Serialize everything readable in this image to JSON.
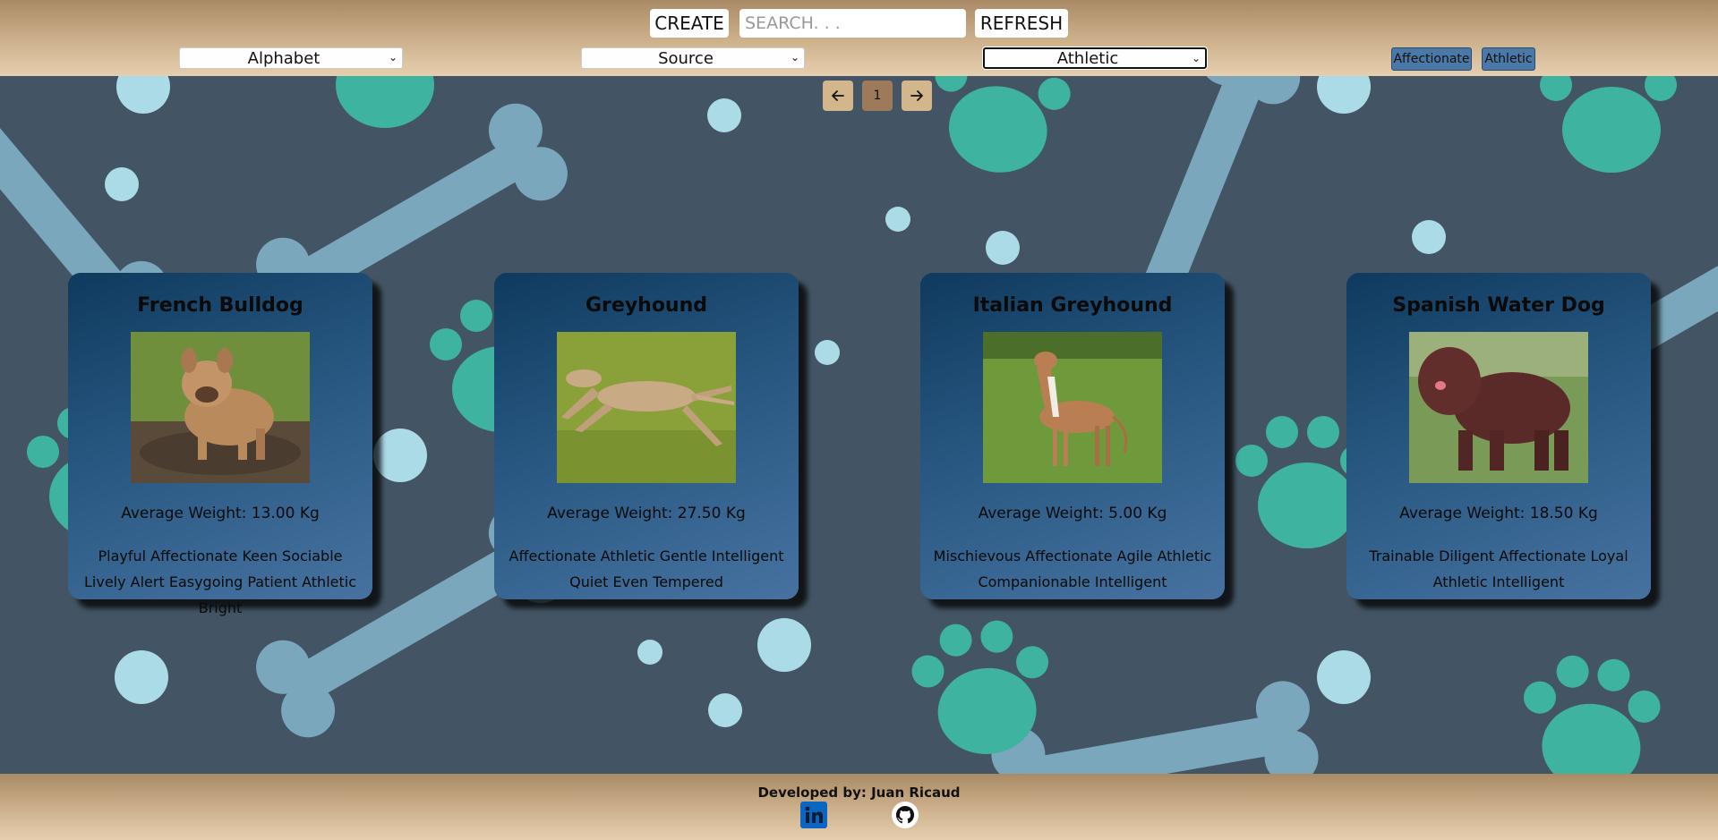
{
  "header": {
    "create_label": "CREATE",
    "search_placeholder": "SEARCH. . .",
    "refresh_label": "REFRESH",
    "filters": [
      {
        "selected": "Alphabet"
      },
      {
        "selected": "Source"
      },
      {
        "selected": "Athletic"
      }
    ],
    "active_tags": [
      "Affectionate",
      "Athletic"
    ]
  },
  "pagination": {
    "prev_icon": "arrow-left-icon",
    "current_page": "1",
    "next_icon": "arrow-right-icon"
  },
  "cards": [
    {
      "name": "French Bulldog",
      "weight": "Average Weight: 13.00 Kg",
      "temperament": "Playful Affectionate Keen Sociable Lively Alert Easygoing Patient Athletic Bright"
    },
    {
      "name": "Greyhound",
      "weight": "Average Weight: 27.50 Kg",
      "temperament": "Affectionate Athletic Gentle Intelligent Quiet Even Tempered"
    },
    {
      "name": "Italian Greyhound",
      "weight": "Average Weight: 5.00 Kg",
      "temperament": "Mischievous Affectionate Agile Athletic Companionable Intelligent"
    },
    {
      "name": "Spanish Water Dog",
      "weight": "Average Weight: 18.50 Kg",
      "temperament": "Trainable Diligent Affectionate Loyal Athletic Intelligent"
    }
  ],
  "footer": {
    "credit": "Developed by: Juan Ricaud",
    "links": [
      "linkedin-icon",
      "github-icon"
    ]
  },
  "colors": {
    "background": "#435564",
    "header_gradient": "#c8ab86",
    "card": "#2a5a84",
    "chip": "#4a79a8",
    "paw": "#3db3a0",
    "bone": "#7aa7bc",
    "dot": "#acdbe8"
  }
}
